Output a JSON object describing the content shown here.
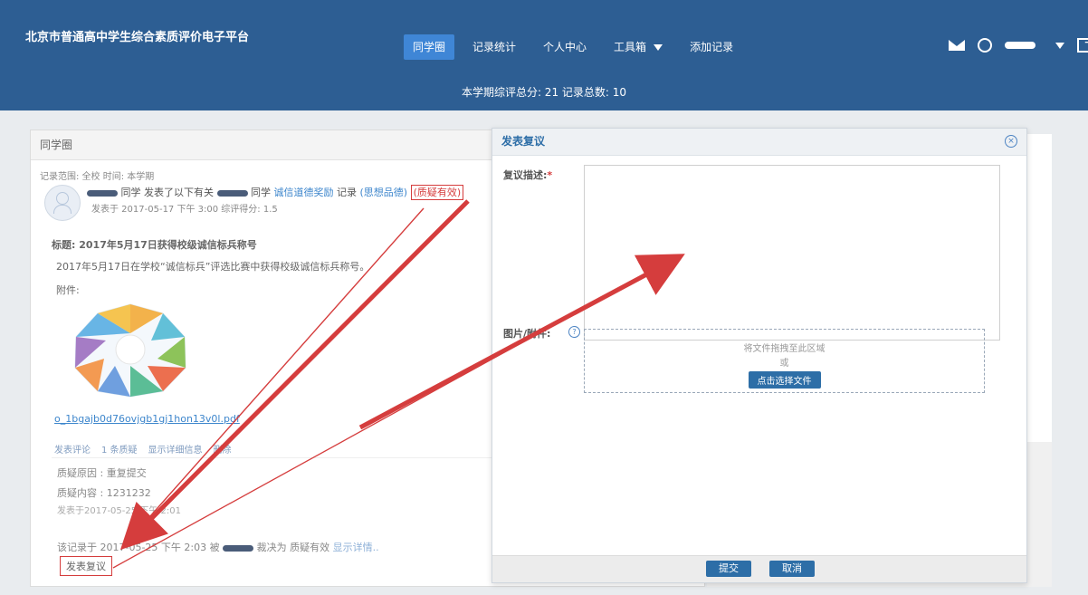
{
  "header": {
    "brand": "北京市普通高中学生综合素质评价电子平台",
    "nav": [
      {
        "label": "同学圈"
      },
      {
        "label": "记录统计"
      },
      {
        "label": "个人中心"
      },
      {
        "label": "工具箱"
      },
      {
        "label": "添加记录"
      }
    ],
    "summary": "本学期综评总分: 21 记录总数: 10"
  },
  "panel": {
    "title": "同学圈",
    "filters": "记录范围: 全校    时间: 本学期",
    "story_text": "同学 发表了以下有关",
    "story_text2": "同学",
    "category": "诚信道德奖励",
    "record": "记录",
    "moral": "(思想品德)",
    "status": "(质疑有效)",
    "meta": "发表于 2017-05-17 下午 3:00  综评得分: 1.5",
    "title_line": "标题: 2017年5月17日获得校级诚信标兵称号",
    "body": "2017年5月17日在学校“诚信标兵”评选比赛中获得校级诚信标兵称号。",
    "attachment_label": "附件:",
    "pdf": "o_1bgajb0d76ovjgb1gj1hon13v0l.pdf",
    "actions": [
      "发表评论",
      "1 条质疑",
      "显示详细信息",
      "删除"
    ],
    "reason": "质疑原因 : 重复提交",
    "reason_content": "质疑内容 : 1231232",
    "reason_time": "发表于2017-05-25 下午 2:01",
    "decision": "该记录于 2017-05-25 下午 2:03 被",
    "decision2": "裁决为",
    "decision_result": "质疑有效",
    "decision_link": "显示详情..",
    "appeal_button": "发表复议"
  },
  "modal": {
    "title": "发表复议",
    "description_label": "复议描述:",
    "attachments_label": "图片/附件:",
    "drop_text": "将文件拖拽至此区域",
    "or_text": "或",
    "choose_text": "点击选择文件",
    "submit": "提交",
    "cancel": "取消"
  }
}
